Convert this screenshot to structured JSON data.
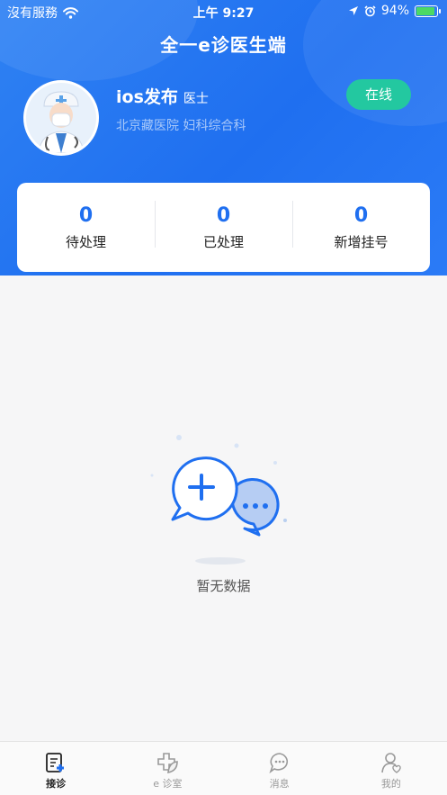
{
  "status_bar": {
    "carrier": "沒有服務",
    "time": "上午 9:27",
    "battery": "94%"
  },
  "header": {
    "title": "全一e诊医生端"
  },
  "doctor": {
    "name": "ios发布",
    "title": "医士",
    "hospital": "北京藏医院 妇科综合科",
    "status_button": "在线"
  },
  "stats": [
    {
      "value": "0",
      "label": "待处理"
    },
    {
      "value": "0",
      "label": "已处理"
    },
    {
      "value": "0",
      "label": "新增挂号"
    }
  ],
  "empty_state": {
    "text": "暂无数据"
  },
  "tabbar": [
    {
      "label": "接诊",
      "icon": "clipboard-plus-icon",
      "active": true
    },
    {
      "label": "e 诊室",
      "icon": "cross-leaf-icon",
      "active": false
    },
    {
      "label": "消息",
      "icon": "chat-bubble-icon",
      "active": false
    },
    {
      "label": "我的",
      "icon": "user-icon",
      "active": false
    }
  ],
  "colors": {
    "primary": "#1f6ff0",
    "online": "#23c8a0",
    "background": "#f6f6f7"
  }
}
